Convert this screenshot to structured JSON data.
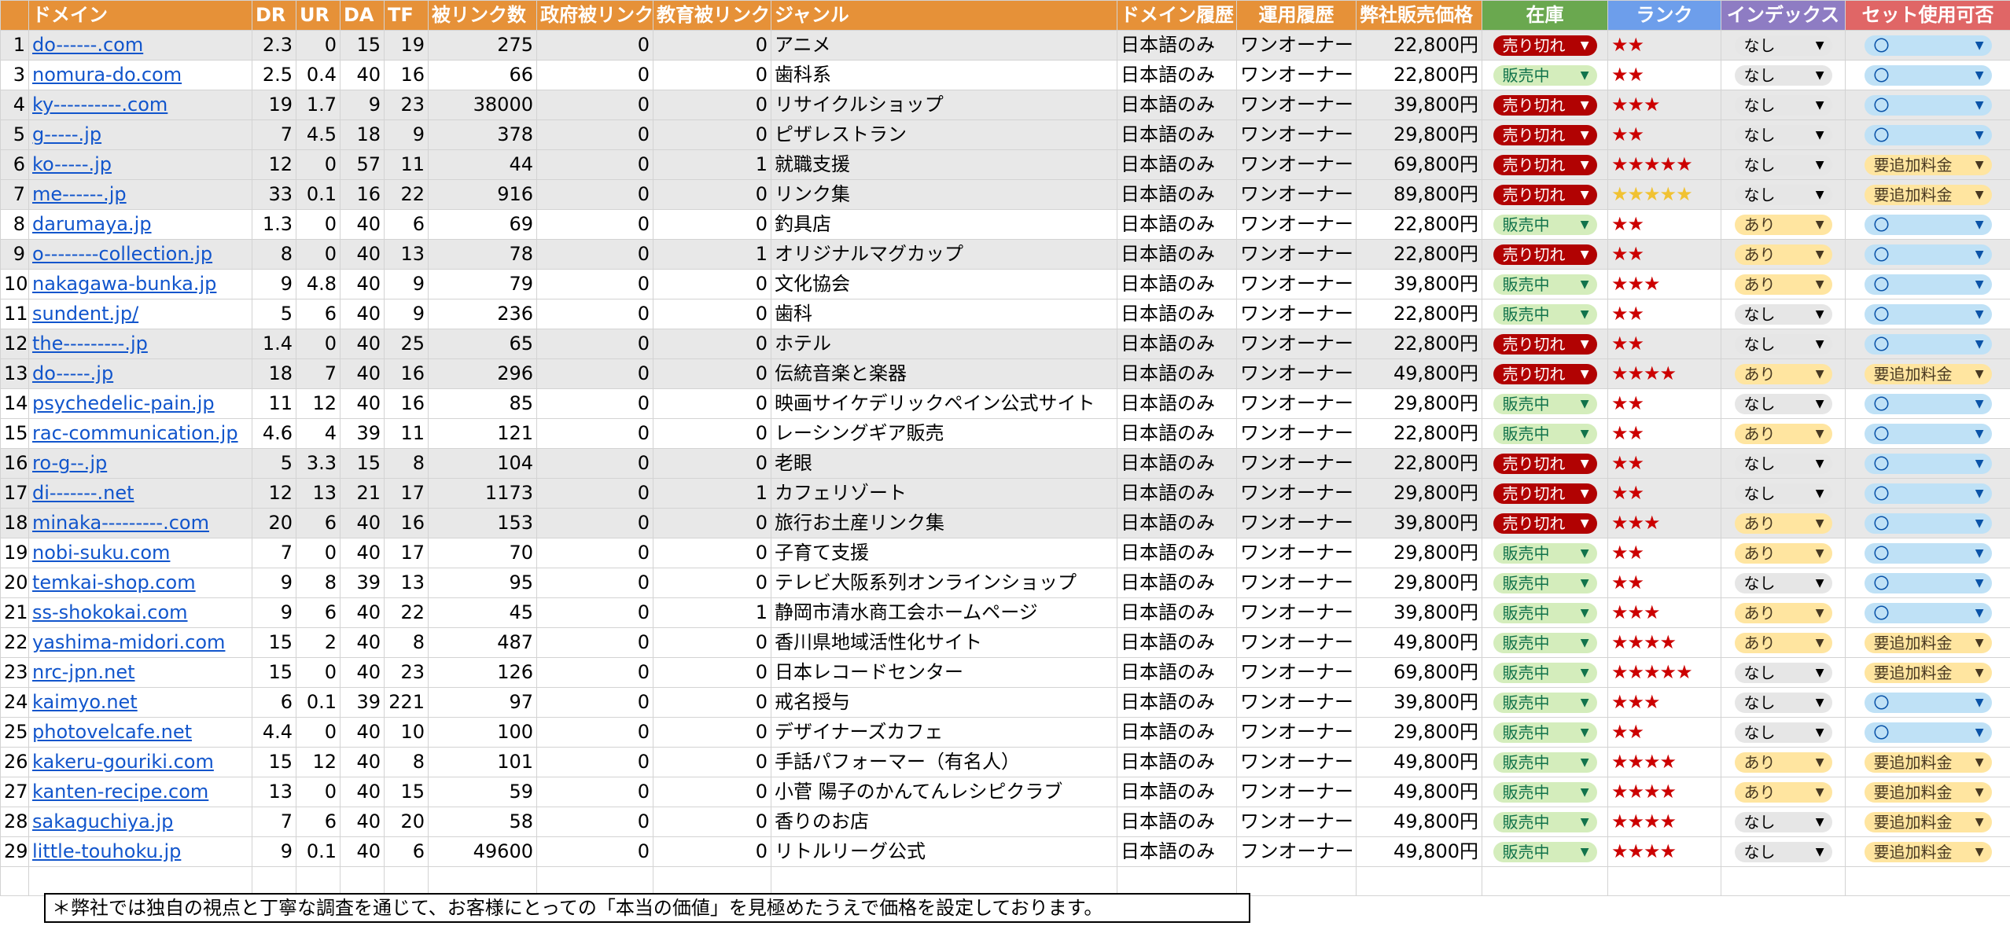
{
  "headers": {
    "rownum": "",
    "domain": "ドメイン",
    "dr": "DR",
    "ur": "UR",
    "da": "DA",
    "tf": "TF",
    "backlinks": "被リンク数",
    "gov": "政府被リンク",
    "edu": "教育被リンク",
    "genre": "ジャンル",
    "history": "ドメイン履歴",
    "ops": "運用履歴",
    "price": "弊社販売価格",
    "stock": "在庫",
    "rank": "ランク",
    "index": "インデックス",
    "set": "セット使用可否"
  },
  "rows": [
    {
      "n": "1",
      "domain": "do------.com",
      "dr": "2.3",
      "ur": "0",
      "da": "15",
      "tf": "19",
      "bl": "275",
      "gov": "0",
      "edu": "0",
      "genre": "アニメ",
      "hist": "日本語のみ",
      "ops": "ワンオーナー",
      "price": "22,800円",
      "stock": "売り切れ",
      "rank": "★★",
      "index": "なし",
      "set": "〇",
      "gray": true
    },
    {
      "n": "3",
      "domain": "nomura-do.com",
      "dr": "2.5",
      "ur": "0.4",
      "da": "40",
      "tf": "16",
      "bl": "66",
      "gov": "0",
      "edu": "0",
      "genre": "歯科系",
      "hist": "日本語のみ",
      "ops": "ワンオーナー",
      "price": "22,800円",
      "stock": "販売中",
      "rank": "★★",
      "index": "なし",
      "set": "〇",
      "gray": false
    },
    {
      "n": "4",
      "domain": "ky----------.com",
      "dr": "19",
      "ur": "1.7",
      "da": "9",
      "tf": "23",
      "bl": "38000",
      "gov": "0",
      "edu": "0",
      "genre": "リサイクルショップ",
      "hist": "日本語のみ",
      "ops": "ワンオーナー",
      "price": "39,800円",
      "stock": "売り切れ",
      "rank": "★★★",
      "index": "なし",
      "set": "〇",
      "gray": true
    },
    {
      "n": "5",
      "domain": "g-----.jp",
      "dr": "7",
      "ur": "4.5",
      "da": "18",
      "tf": "9",
      "bl": "378",
      "gov": "0",
      "edu": "0",
      "genre": "ピザレストラン",
      "hist": "日本語のみ",
      "ops": "ワンオーナー",
      "price": "29,800円",
      "stock": "売り切れ",
      "rank": "★★",
      "index": "なし",
      "set": "〇",
      "gray": true
    },
    {
      "n": "6",
      "domain": "ko-----.jp",
      "dr": "12",
      "ur": "0",
      "da": "57",
      "tf": "11",
      "bl": "44",
      "gov": "0",
      "edu": "1",
      "genre": "就職支援",
      "hist": "日本語のみ",
      "ops": "ワンオーナー",
      "price": "69,800円",
      "stock": "売り切れ",
      "rank": "★★★★★",
      "index": "なし",
      "set": "要追加料金",
      "gray": true
    },
    {
      "n": "7",
      "domain": "me------.jp",
      "dr": "33",
      "ur": "0.1",
      "da": "16",
      "tf": "22",
      "bl": "916",
      "gov": "0",
      "edu": "0",
      "genre": "リンク集",
      "hist": "日本語のみ",
      "ops": "ワンオーナー",
      "price": "89,800円",
      "stock": "売り切れ",
      "rank": "★★★★★",
      "gold": true,
      "index": "なし",
      "set": "要追加料金",
      "gray": true
    },
    {
      "n": "8",
      "domain": "darumaya.jp",
      "dr": "1.3",
      "ur": "0",
      "da": "40",
      "tf": "6",
      "bl": "69",
      "gov": "0",
      "edu": "0",
      "genre": "釣具店",
      "hist": "日本語のみ",
      "ops": "ワンオーナー",
      "price": "22,800円",
      "stock": "販売中",
      "rank": "★★",
      "index": "あり",
      "set": "〇",
      "gray": false
    },
    {
      "n": "9",
      "domain": "o--------collection.jp",
      "dr": "8",
      "ur": "0",
      "da": "40",
      "tf": "13",
      "bl": "78",
      "gov": "0",
      "edu": "1",
      "genre": "オリジナルマグカップ",
      "hist": "日本語のみ",
      "ops": "ワンオーナー",
      "price": "22,800円",
      "stock": "売り切れ",
      "rank": "★★",
      "index": "あり",
      "set": "〇",
      "gray": true
    },
    {
      "n": "10",
      "domain": "nakagawa-bunka.jp",
      "dr": "9",
      "ur": "4.8",
      "da": "40",
      "tf": "9",
      "bl": "79",
      "gov": "0",
      "edu": "0",
      "genre": "文化協会",
      "hist": "日本語のみ",
      "ops": "ワンオーナー",
      "price": "39,800円",
      "stock": "販売中",
      "rank": "★★★",
      "index": "あり",
      "set": "〇",
      "gray": false
    },
    {
      "n": "11",
      "domain": "sundent.jp/",
      "dr": "5",
      "ur": "6",
      "da": "40",
      "tf": "9",
      "bl": "236",
      "gov": "0",
      "edu": "0",
      "genre": "歯科",
      "hist": "日本語のみ",
      "ops": "ワンオーナー",
      "price": "22,800円",
      "stock": "販売中",
      "rank": "★★",
      "index": "なし",
      "set": "〇",
      "gray": false
    },
    {
      "n": "12",
      "domain": "the---------.jp",
      "dr": "1.4",
      "ur": "0",
      "da": "40",
      "tf": "25",
      "bl": "65",
      "gov": "0",
      "edu": "0",
      "genre": "ホテル",
      "hist": "日本語のみ",
      "ops": "ワンオーナー",
      "price": "22,800円",
      "stock": "売り切れ",
      "rank": "★★",
      "index": "なし",
      "set": "〇",
      "gray": true
    },
    {
      "n": "13",
      "domain": "do-----.jp",
      "dr": "18",
      "ur": "7",
      "da": "40",
      "tf": "16",
      "bl": "296",
      "gov": "0",
      "edu": "0",
      "genre": "伝統音楽と楽器",
      "hist": "日本語のみ",
      "ops": "ワンオーナー",
      "price": "49,800円",
      "stock": "売り切れ",
      "rank": "★★★★",
      "index": "あり",
      "set": "要追加料金",
      "gray": true
    },
    {
      "n": "14",
      "domain": "psychedelic-pain.jp",
      "dr": "11",
      "ur": "12",
      "da": "40",
      "tf": "16",
      "bl": "85",
      "gov": "0",
      "edu": "0",
      "genre": "映画サイケデリックペイン公式サイト",
      "hist": "日本語のみ",
      "ops": "ワンオーナー",
      "price": "29,800円",
      "stock": "販売中",
      "rank": "★★",
      "index": "なし",
      "set": "〇",
      "gray": false
    },
    {
      "n": "15",
      "domain": "rac-communication.jp",
      "dr": "4.6",
      "ur": "4",
      "da": "39",
      "tf": "11",
      "bl": "121",
      "gov": "0",
      "edu": "0",
      "genre": "レーシングギア販売",
      "hist": "日本語のみ",
      "ops": "ワンオーナー",
      "price": "22,800円",
      "stock": "販売中",
      "rank": "★★",
      "index": "あり",
      "set": "〇",
      "gray": false
    },
    {
      "n": "16",
      "domain": "ro-g--.jp",
      "dr": "5",
      "ur": "3.3",
      "da": "15",
      "tf": "8",
      "bl": "104",
      "gov": "0",
      "edu": "0",
      "genre": "老眼",
      "hist": "日本語のみ",
      "ops": "ワンオーナー",
      "price": "22,800円",
      "stock": "売り切れ",
      "rank": "★★",
      "index": "なし",
      "set": "〇",
      "gray": true
    },
    {
      "n": "17",
      "domain": "di-------.net",
      "dr": "12",
      "ur": "13",
      "da": "21",
      "tf": "17",
      "bl": "1173",
      "gov": "0",
      "edu": "1",
      "genre": "カフェリゾート",
      "hist": "日本語のみ",
      "ops": "ワンオーナー",
      "price": "29,800円",
      "stock": "売り切れ",
      "rank": "★★",
      "index": "なし",
      "set": "〇",
      "gray": true
    },
    {
      "n": "18",
      "domain": "minaka---------.com",
      "dr": "20",
      "ur": "6",
      "da": "40",
      "tf": "16",
      "bl": "153",
      "gov": "0",
      "edu": "0",
      "genre": "旅行お土産リンク集",
      "hist": "日本語のみ",
      "ops": "ワンオーナー",
      "price": "39,800円",
      "stock": "売り切れ",
      "rank": "★★★",
      "index": "あり",
      "set": "〇",
      "gray": true
    },
    {
      "n": "19",
      "domain": "nobi-suku.com",
      "dr": "7",
      "ur": "0",
      "da": "40",
      "tf": "17",
      "bl": "70",
      "gov": "0",
      "edu": "0",
      "genre": "子育て支援",
      "hist": "日本語のみ",
      "ops": "ワンオーナー",
      "price": "29,800円",
      "stock": "販売中",
      "rank": "★★",
      "index": "あり",
      "set": "〇",
      "gray": false
    },
    {
      "n": "20",
      "domain": "temkai-shop.com",
      "dr": "9",
      "ur": "8",
      "da": "39",
      "tf": "13",
      "bl": "95",
      "gov": "0",
      "edu": "0",
      "genre": "テレビ大阪系列オンラインショップ",
      "hist": "日本語のみ",
      "ops": "ワンオーナー",
      "price": "29,800円",
      "stock": "販売中",
      "rank": "★★",
      "index": "なし",
      "set": "〇",
      "gray": false
    },
    {
      "n": "21",
      "domain": "ss-shokokai.com",
      "dr": "9",
      "ur": "6",
      "da": "40",
      "tf": "22",
      "bl": "45",
      "gov": "0",
      "edu": "1",
      "genre": "静岡市清水商工会ホームページ",
      "hist": "日本語のみ",
      "ops": "ワンオーナー",
      "price": "39,800円",
      "stock": "販売中",
      "rank": "★★★",
      "index": "あり",
      "set": "〇",
      "gray": false
    },
    {
      "n": "22",
      "domain": "yashima-midori.com",
      "dr": "15",
      "ur": "2",
      "da": "40",
      "tf": "8",
      "bl": "487",
      "gov": "0",
      "edu": "0",
      "genre": "香川県地域活性化サイト",
      "hist": "日本語のみ",
      "ops": "ワンオーナー",
      "price": "49,800円",
      "stock": "販売中",
      "rank": "★★★★",
      "index": "あり",
      "set": "要追加料金",
      "gray": false
    },
    {
      "n": "23",
      "domain": "nrc-jpn.net",
      "dr": "15",
      "ur": "0",
      "da": "40",
      "tf": "23",
      "bl": "126",
      "gov": "0",
      "edu": "0",
      "genre": "日本レコードセンター",
      "hist": "日本語のみ",
      "ops": "ワンオーナー",
      "price": "69,800円",
      "stock": "販売中",
      "rank": "★★★★★",
      "index": "なし",
      "set": "要追加料金",
      "gray": false
    },
    {
      "n": "24",
      "domain": "kaimyo.net",
      "dr": "6",
      "ur": "0.1",
      "da": "39",
      "tf": "221",
      "bl": "97",
      "gov": "0",
      "edu": "0",
      "genre": "戒名授与",
      "hist": "日本語のみ",
      "ops": "ワンオーナー",
      "price": "39,800円",
      "stock": "販売中",
      "rank": "★★★",
      "index": "なし",
      "set": "〇",
      "gray": false
    },
    {
      "n": "25",
      "domain": "photovelcafe.net",
      "dr": "4.4",
      "ur": "0",
      "da": "40",
      "tf": "10",
      "bl": "100",
      "gov": "0",
      "edu": "0",
      "genre": "デザイナーズカフェ",
      "hist": "日本語のみ",
      "ops": "ワンオーナー",
      "price": "29,800円",
      "stock": "販売中",
      "rank": "★★",
      "index": "なし",
      "set": "〇",
      "gray": false
    },
    {
      "n": "26",
      "domain": "kakeru-gouriki.com",
      "dr": "15",
      "ur": "12",
      "da": "40",
      "tf": "8",
      "bl": "101",
      "gov": "0",
      "edu": "0",
      "genre": "手話パフォーマー（有名人）",
      "hist": "日本語のみ",
      "ops": "ワンオーナー",
      "price": "49,800円",
      "stock": "販売中",
      "rank": "★★★★",
      "index": "あり",
      "set": "要追加料金",
      "gray": false
    },
    {
      "n": "27",
      "domain": "kanten-recipe.com",
      "dr": "13",
      "ur": "0",
      "da": "40",
      "tf": "15",
      "bl": "59",
      "gov": "0",
      "edu": "0",
      "genre": "小菅 陽子のかんてんレシピクラブ",
      "hist": "日本語のみ",
      "ops": "ワンオーナー",
      "price": "49,800円",
      "stock": "販売中",
      "rank": "★★★★",
      "index": "あり",
      "set": "要追加料金",
      "gray": false
    },
    {
      "n": "28",
      "domain": "sakaguchiya.jp",
      "dr": "7",
      "ur": "6",
      "da": "40",
      "tf": "20",
      "bl": "58",
      "gov": "0",
      "edu": "0",
      "genre": "香りのお店",
      "hist": "日本語のみ",
      "ops": "ワンオーナー",
      "price": "49,800円",
      "stock": "販売中",
      "rank": "★★★★",
      "index": "なし",
      "set": "要追加料金",
      "gray": false
    },
    {
      "n": "29",
      "domain": "little-touhoku.jp",
      "dr": "9",
      "ur": "0.1",
      "da": "40",
      "tf": "6",
      "bl": "49600",
      "gov": "0",
      "edu": "0",
      "genre": "リトルリーグ公式",
      "hist": "日本語のみ",
      "ops": "フンオーナー",
      "price": "49,800円",
      "stock": "販売中",
      "rank": "★★★★",
      "index": "なし",
      "set": "要追加料金",
      "gray": false
    }
  ],
  "note": "＊弊社では独自の視点と丁寧な調査を通じて、お客様にとっての「本当の価値」を見極めたうえで価格を設定しております。",
  "colors": {
    "header_orange": "#e69138",
    "header_green": "#6aa84f",
    "header_blue": "#6d9eeb",
    "header_purple": "#8e7cc3",
    "header_red": "#e06666",
    "sold_out": "#b10202",
    "on_sale": "#d4edbc",
    "link": "#1155cc",
    "star_red": "#cc0000",
    "star_gold": "#f1c232"
  },
  "icons": {
    "dropdown": "chevron-down-icon",
    "rank": "star-icon"
  }
}
